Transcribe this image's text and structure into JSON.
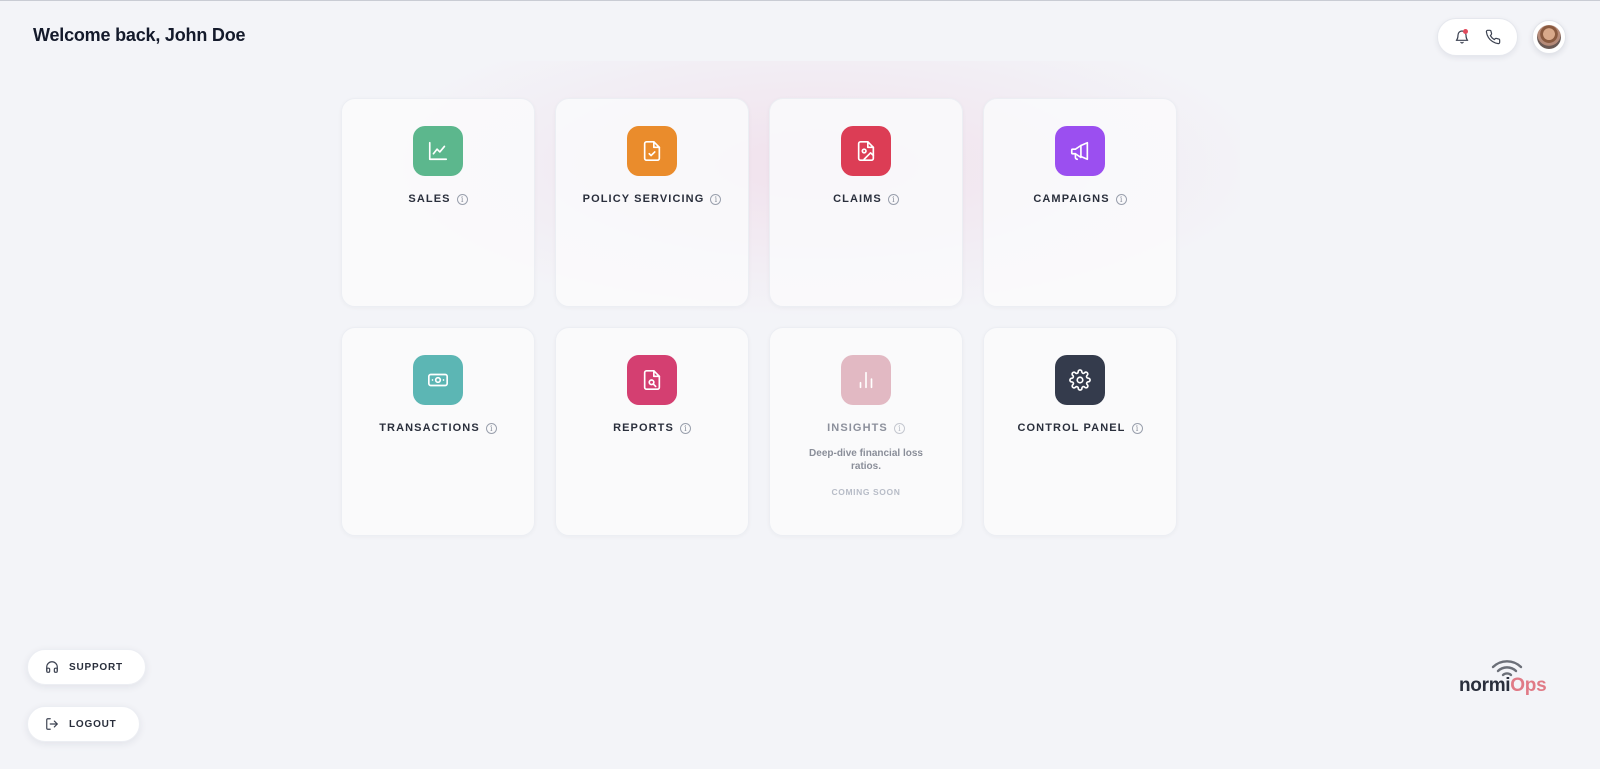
{
  "header": {
    "welcome": "Welcome back, John Doe"
  },
  "top_actions": {
    "notification_icon": "bell-icon",
    "phone_icon": "phone-icon",
    "notification_dot_color": "#e14a5c"
  },
  "cards": [
    {
      "label": "SALES",
      "icon": "chart-line-icon",
      "color": "#5cb78d"
    },
    {
      "label": "POLICY SERVICING",
      "icon": "document-check-icon",
      "color": "#ea8c2c"
    },
    {
      "label": "CLAIMS",
      "icon": "file-image-icon",
      "color": "#dc3d55"
    },
    {
      "label": "CAMPAIGNS",
      "icon": "megaphone-icon",
      "color": "#9b4ff0"
    },
    {
      "label": "TRANSACTIONS",
      "icon": "banknote-icon",
      "color": "#5cb6b4"
    },
    {
      "label": "REPORTS",
      "icon": "document-search-icon",
      "color": "#d43f71"
    },
    {
      "label": "INSIGHTS",
      "icon": "bar-chart-icon",
      "color": "#e2b9c3",
      "description": "Deep-dive financial loss ratios.",
      "status": "COMING SOON",
      "disabled": true
    },
    {
      "label": "CONTROL PANEL",
      "icon": "gear-icon",
      "color": "#343b4c"
    }
  ],
  "sidebar": {
    "support_label": "SUPPORT",
    "logout_label": "LOGOUT"
  },
  "logo": {
    "part1": "normi",
    "part2": "Ops"
  }
}
